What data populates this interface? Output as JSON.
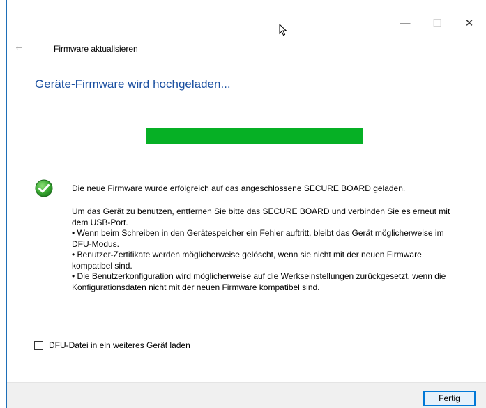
{
  "window": {
    "header_title": "Firmware aktualisieren",
    "caption": {
      "minimize": "—",
      "maximize": "☐",
      "close": "✕"
    },
    "back": "←"
  },
  "main": {
    "heading": "Geräte-Firmware wird hochgeladen...",
    "progress_fraction": 1.0,
    "progress_color": "#06b025",
    "success_message": "Die neue Firmware wurde erfolgreich auf das angeschlossene SECURE BOARD geladen.",
    "info_paragraphs": [
      "Um das Gerät zu benutzen, entfernen Sie bitte das SECURE BOARD und verbinden Sie es erneut mit dem USB-Port.",
      "• Wenn beim Schreiben in den Gerätespeicher ein Fehler auftritt, bleibt das Gerät möglicherweise im DFU-Modus.",
      "• Benutzer-Zertifikate werden möglicherweise gelöscht, wenn sie nicht mit der neuen Firmware kompatibel sind.",
      "• Die Benutzerkonfiguration wird möglicherweise auf die Werkseinstellungen zurückgesetzt, wenn die Konfigurationsdaten nicht mit der neuen Firmware kompatibel sind."
    ],
    "checkbox": {
      "accel": "D",
      "label_rest": "FU-Datei in ein weiteres Gerät laden",
      "checked": false
    }
  },
  "footer": {
    "finish_accel": "F",
    "finish_rest": "ertig"
  },
  "colors": {
    "heading": "#1a4fa0",
    "accent": "#0078d7"
  }
}
